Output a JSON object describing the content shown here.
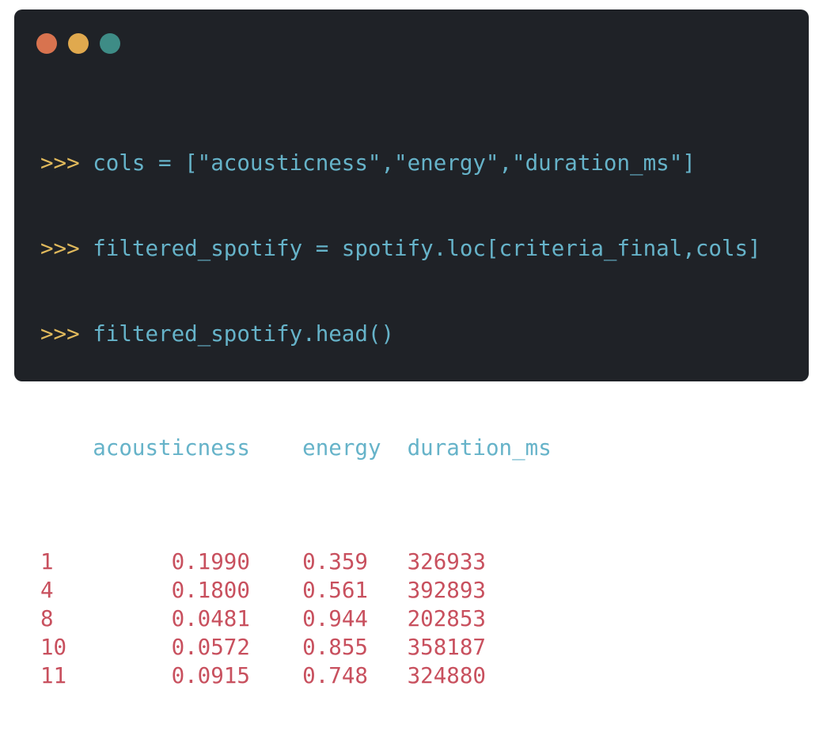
{
  "window": {
    "dots": [
      {
        "name": "close",
        "color": "#d8734f"
      },
      {
        "name": "minimize",
        "color": "#e0a94e"
      },
      {
        "name": "zoom",
        "color": "#3e8c86"
      }
    ]
  },
  "code": {
    "prompt": ">>>",
    "lines": [
      {
        "text": "cols = [\"acousticness\",\"energy\",\"duration_ms\"]"
      },
      {
        "text": "filtered_spotify = spotify.loc[criteria_final,cols]"
      },
      {
        "text": "filtered_spotify.head()"
      }
    ],
    "output": {
      "columns": [
        "acousticness",
        "energy",
        "duration_ms"
      ],
      "rows": [
        {
          "index": "1",
          "acousticness": "0.1990",
          "energy": "0.359",
          "duration_ms": "326933"
        },
        {
          "index": "4",
          "acousticness": "0.1800",
          "energy": "0.561",
          "duration_ms": "392893"
        },
        {
          "index": "8",
          "acousticness": "0.0481",
          "energy": "0.944",
          "duration_ms": "202853"
        },
        {
          "index": "10",
          "acousticness": "0.0572",
          "energy": "0.855",
          "duration_ms": "358187"
        },
        {
          "index": "11",
          "acousticness": "0.0915",
          "energy": "0.748",
          "duration_ms": "324880"
        }
      ]
    }
  }
}
